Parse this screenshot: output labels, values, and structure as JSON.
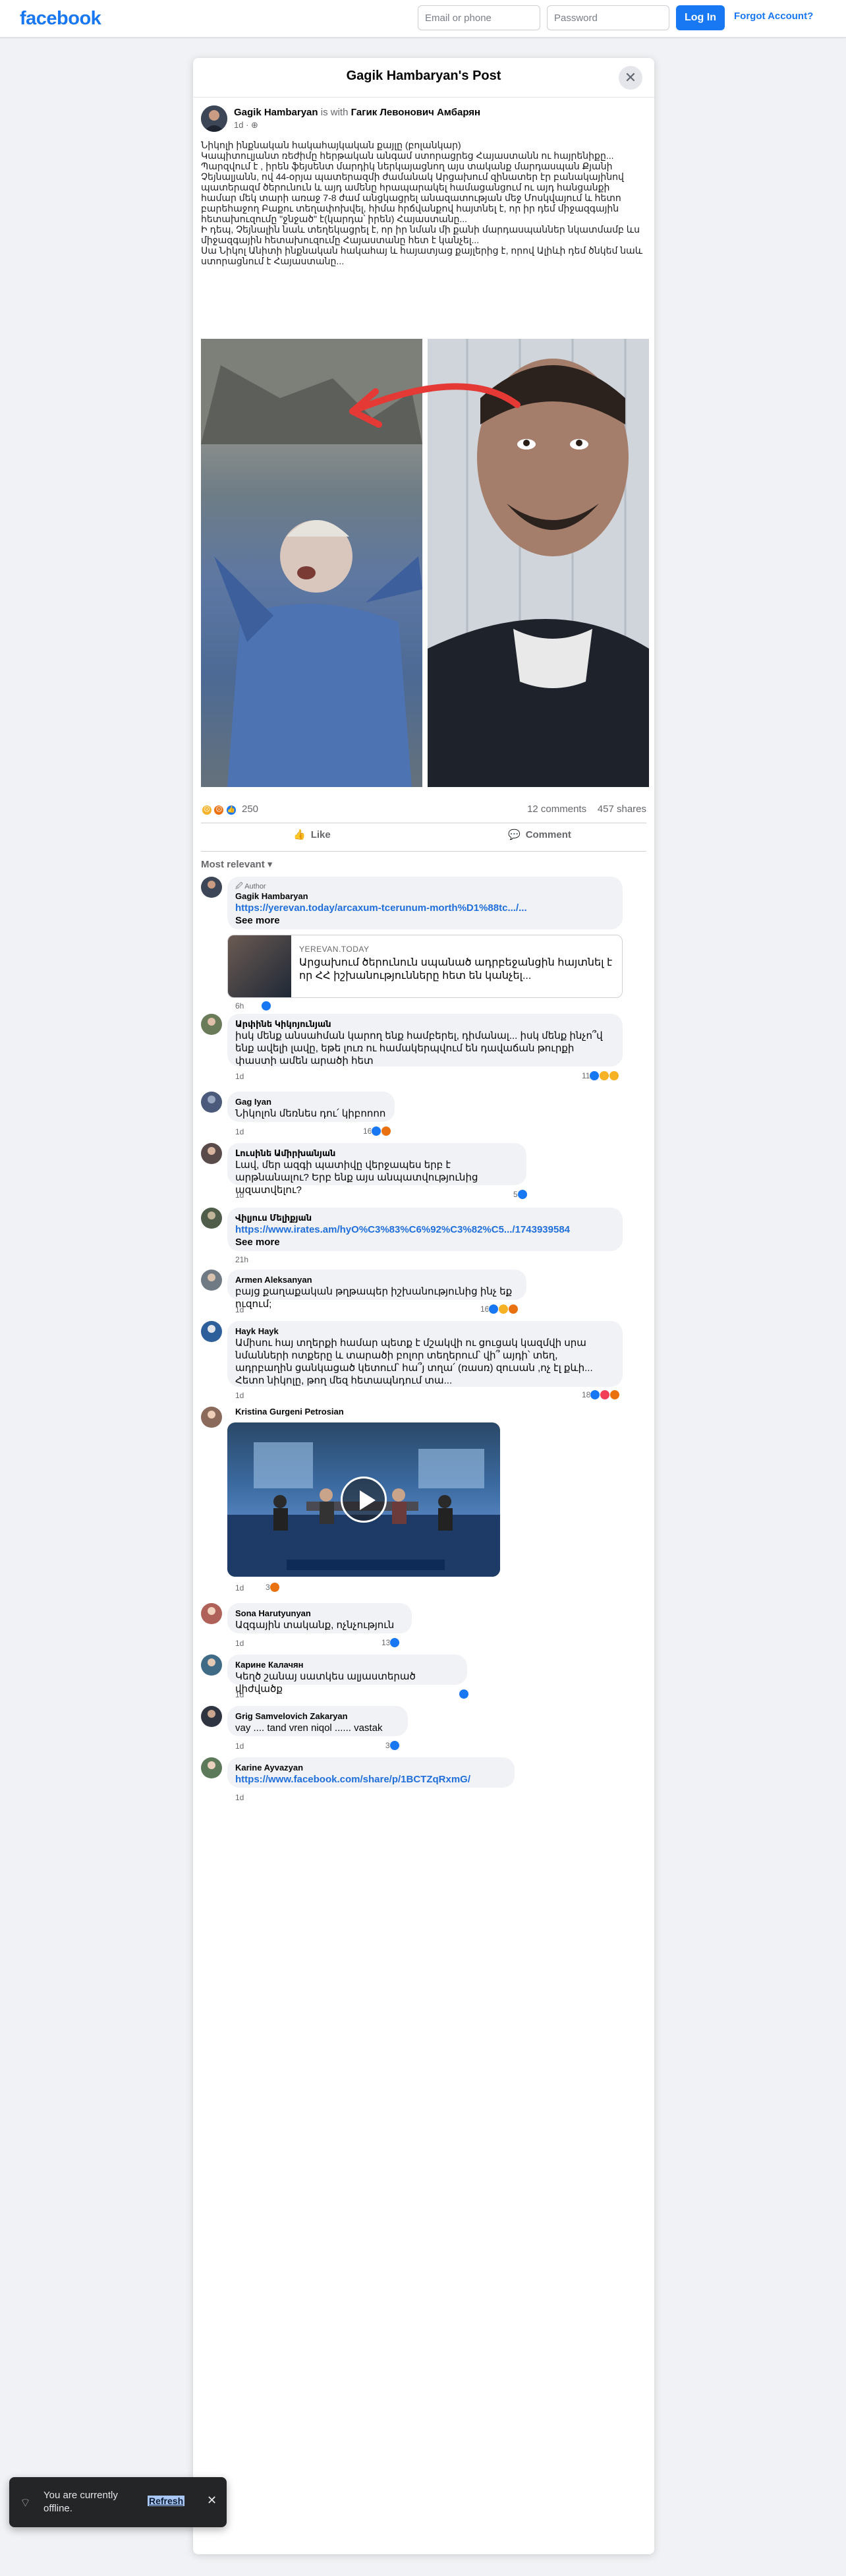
{
  "header": {
    "logo": "facebook",
    "email_placeholder": "Email or phone",
    "password_placeholder": "Password",
    "login_label": "Log In",
    "forgot_label": "Forgot Account?"
  },
  "dialog": {
    "title": "Gagik Hambaryan's Post",
    "close_icon": "close-icon"
  },
  "post": {
    "author": "Gagik Hambaryan",
    "with_text": "is with",
    "tagged": "Гагик Левонович Амбарян",
    "time": "1d",
    "privacy_icon": "globe-icon",
    "text": "Նիկոլի ինքնական հակահայկական քայլը (բոլանկար)\nԿապիտուլյանտ ռեժիմը հերթական անգամ ստորացրեց Հայաստանն ու հայրենիքը...\nՊարզվում է , իրեն ֆեյսենտ մարդիկ ներկայացնող այս տականք մարդասպան Քյանի Չեյնալյանն, ով 44-օրյա պատերազմի ժամանակ Արցախում զինատեր էր բանակայինով պատերազմ ծերունուն և այդ ամենը հրապարակել համացանցում ու այդ հանցանքի համար  մեկ տարի առաջ 7-8 ժամ անցկացրել անազատության մեջ Մոսկվայում և հետո բարեհաջող Բաքու տեղափոխվել, հիմա հրճվանքով հայտնել է, որ իր դեմ միջազգային հետախուզումը \"ջնջած\" է(կարդա՝ իրեն) Հայաստանը...\nԻ դեպ, Չեյնալին նաև տեղեկացրել է, որ իր նման մի քանի մարդասպաններ նկատմամբ ևս միջազգային հետախուզումը Հայաստանը հետ է կանչել...\nՍա Նիկոլ Անիտի ինքնական հակահայ և հայատյաց քայլերից է, որով Ալիևի դեմ ծնկեմ նաև ստորացնում է Հայաստանը...",
    "reaction_count": "250",
    "comments_count": "12 comments",
    "shares_count": "457 shares",
    "like_label": "Like",
    "comment_label": "Comment",
    "sort_label": "Most relevant"
  },
  "comments": [
    {
      "name": "Gagik Hambaryan",
      "author_label": "Author",
      "link": "https://yerevan.today/arcaxum-tcerunum-morth%D1%88tc.../...",
      "see_more": "See more",
      "card_site": "YEREVAN.TODAY",
      "card_title": "Արցախում ծերունուն սպանած ադրբեջանցին հայտնել է որ ՀՀ իշխանությունները հետ են կանչել...",
      "time": "6h"
    },
    {
      "name": "Արփինե Կիկոյունյան",
      "text": "իսկ մենք անսահման կարող ենք համբերել, դիմանալ... իսկ մենք ինչո՞վ ենք ավելի լավը, եթե լուռ ու համակերպվում են դավաճան թուրքի փաստի ամեն արածի հետ",
      "time": "1d",
      "reacts": "11"
    },
    {
      "name": "Gag Iyan",
      "text": "Նիկոլոն մեռնես դու՛ կիբոոոո",
      "time": "1d",
      "reacts": "16"
    },
    {
      "name": "Լուսինե Ամիրխանյան",
      "text": "Լավ, մեր ազգի պատիվը վերջապես երբ է արթնանալու? Երբ ենք այս անպատվությունից ազատվելու?",
      "time": "1d",
      "reacts": "5"
    },
    {
      "name": "Վիլյուս Մելիքյան",
      "link": "https://www.irates.am/hyO%C3%83%C6%92%C3%82%C5.../1743939584",
      "see_more": "See more",
      "time": "21h"
    },
    {
      "name": "Armen Aleksanyan",
      "text": "բայց քաղաքական թղթապեր իշխանությունից ինչ եք ուզում;",
      "time": "1d",
      "reacts": "16"
    },
    {
      "name": "Hayk Hayk",
      "text": "Ամիսու հայ տղերքի համար պետք է մշակվի ու ցուցակ կազմվի սրա նմանների ոտքերը և տարածի բոլոր տեղերում՝ վի՞ այդի՝ տեղ, ադրբաղին ցանկացած կետում՝ հա՞յ տղա՛ (ռասռ) զուսան ,ոչ էլ քևի... Հետո նիկոլը, թող մեզ հետապնդում տա...",
      "time": "1d",
      "reacts": "18"
    },
    {
      "name": "Kristina Gurgeni Petrosian",
      "time": "1d",
      "reacts": "3"
    },
    {
      "name": "Sona Harutyunyan",
      "text": "Ազգային տականք, ոչնչություն",
      "time": "1d",
      "reacts": "13"
    },
    {
      "name": "Карине Калачян",
      "text": "Կեղծ շանայ սատկես ալյաստերած վիժվածք",
      "time": "1d"
    },
    {
      "name": "Grig Samvelovich Zakaryan",
      "text": "vay .... tand vren niqol ...... vastak",
      "time": "1d",
      "reacts": "3"
    },
    {
      "name": "Karine Ayvazyan",
      "link": "https://www.facebook.com/share/p/1BCTZqRxmG/",
      "time": "1d"
    }
  ],
  "toast": {
    "text": "You are currently offline.",
    "refresh": "Refresh"
  }
}
